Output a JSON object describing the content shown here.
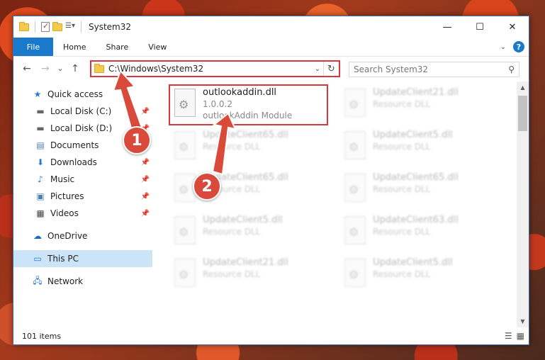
{
  "window": {
    "title": "System32",
    "controls": {
      "minimize": "—",
      "maximize": "☐",
      "close": "✕"
    }
  },
  "ribbon": {
    "tabs": [
      "File",
      "Home",
      "Share",
      "View"
    ],
    "help": "?"
  },
  "nav": {
    "back": "←",
    "forward": "→",
    "recent": "⌄",
    "up": "↑",
    "address": "C:\\Windows\\System32",
    "refresh": "↻",
    "search_placeholder": "Search System32"
  },
  "sidebar": {
    "items": [
      {
        "label": "Quick access",
        "icon": "star-icon",
        "pinned": false
      },
      {
        "label": "Local Disk (C:)",
        "icon": "drive-icon",
        "pinned": true
      },
      {
        "label": "Local Disk (D:)",
        "icon": "drive-icon",
        "pinned": true
      },
      {
        "label": "Documents",
        "icon": "documents-icon",
        "pinned": true
      },
      {
        "label": "Downloads",
        "icon": "downloads-icon",
        "pinned": true
      },
      {
        "label": "Music",
        "icon": "music-icon",
        "pinned": true
      },
      {
        "label": "Pictures",
        "icon": "pictures-icon",
        "pinned": true
      },
      {
        "label": "Videos",
        "icon": "videos-icon",
        "pinned": true
      },
      {
        "label": "OneDrive",
        "icon": "onedrive-icon",
        "pinned": false
      },
      {
        "label": "This PC",
        "icon": "computer-icon",
        "pinned": false
      },
      {
        "label": "Network",
        "icon": "network-icon",
        "pinned": false
      }
    ]
  },
  "files": [
    {
      "name": "outlookaddin.dll",
      "line2": "1.0.0.2",
      "line3": "outlookAddin Module"
    },
    {
      "name": "UpdateClient21.dll",
      "line2": "Resource DLL"
    },
    {
      "name": "UpdateClient65.dll",
      "line2": "Resource DLL"
    },
    {
      "name": "UpdateClient5.dll",
      "line2": "Resource DLL"
    },
    {
      "name": "UpdateClient65.dll",
      "line2": "Resource DLL"
    },
    {
      "name": "UpdateClient65.dll",
      "line2": "Resource DLL"
    },
    {
      "name": "UpdateClient5.dll",
      "line2": "Resource DLL"
    },
    {
      "name": "UpdateClient63.dll",
      "line2": "Resource DLL"
    },
    {
      "name": "UpdateClient21.dll",
      "line2": "Resource DLL"
    },
    {
      "name": "UpdateClient5.dll",
      "line2": "Resource DLL"
    }
  ],
  "status": {
    "count": "101 items"
  },
  "annotations": {
    "step1": "1",
    "step2": "2",
    "color": "#d94a3a"
  }
}
